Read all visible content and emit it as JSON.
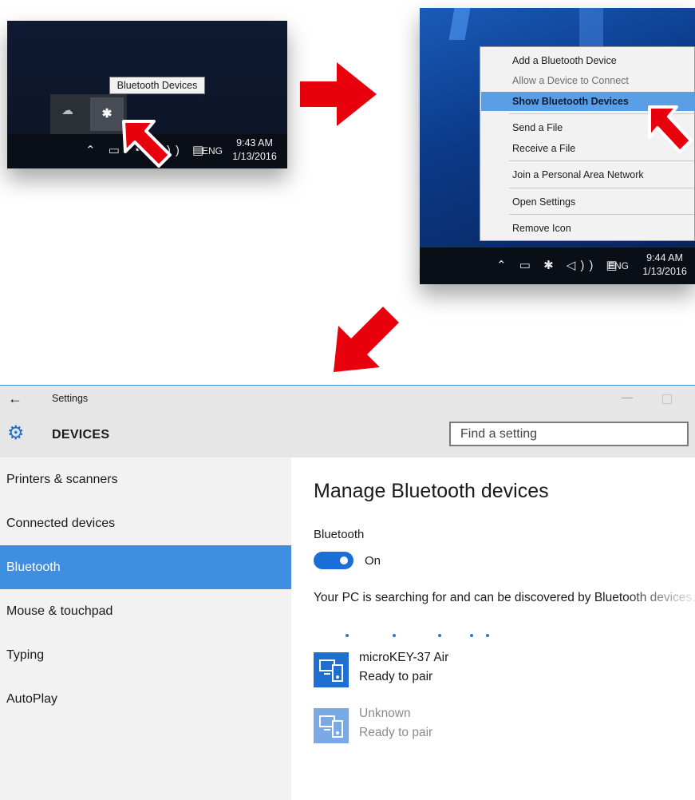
{
  "step1": {
    "tooltip": "Bluetooth Devices",
    "icons": {
      "onedrive": "onedrive-icon",
      "bluetooth": "bluetooth-icon"
    },
    "taskbar": {
      "language": "ENG",
      "time": "9:43 AM",
      "date": "1/13/2016"
    }
  },
  "step2": {
    "menu": [
      {
        "label": "Add a Bluetooth Device",
        "state": "normal"
      },
      {
        "label": "Allow a Device to Connect",
        "state": "disabled"
      },
      {
        "label": "Show Bluetooth Devices",
        "state": "selected"
      },
      {
        "label": "Send a File",
        "state": "normal"
      },
      {
        "label": "Receive a File",
        "state": "normal"
      },
      {
        "label": "Join a Personal Area Network",
        "state": "normal"
      },
      {
        "label": "Open Settings",
        "state": "normal"
      },
      {
        "label": "Remove Icon",
        "state": "normal"
      }
    ],
    "taskbar": {
      "language": "ENG",
      "time": "9:44 AM",
      "date": "1/13/2016"
    }
  },
  "settings": {
    "window_title": "Settings",
    "section_title": "DEVICES",
    "search_placeholder": "Find a setting",
    "nav": [
      {
        "label": "Printers & scanners",
        "active": false
      },
      {
        "label": "Connected devices",
        "active": false
      },
      {
        "label": "Bluetooth",
        "active": true
      },
      {
        "label": "Mouse & touchpad",
        "active": false
      },
      {
        "label": "Typing",
        "active": false
      },
      {
        "label": "AutoPlay",
        "active": false
      }
    ],
    "content": {
      "heading": "Manage Bluetooth devices",
      "bluetooth_label": "Bluetooth",
      "toggle_state": "On",
      "toggle_on": true,
      "description": "Your PC is searching for and can be discovered by Bluetooth devices.",
      "devices": [
        {
          "name": "microKEY-37 Air",
          "status": "Ready to pair",
          "dimmed": false
        },
        {
          "name": "Unknown",
          "status": "Ready to pair",
          "dimmed": true
        }
      ]
    }
  },
  "colors": {
    "accent": "#3f8ee0",
    "arrow_red": "#e8000d",
    "menu_highlight": "#5a9ee6"
  }
}
